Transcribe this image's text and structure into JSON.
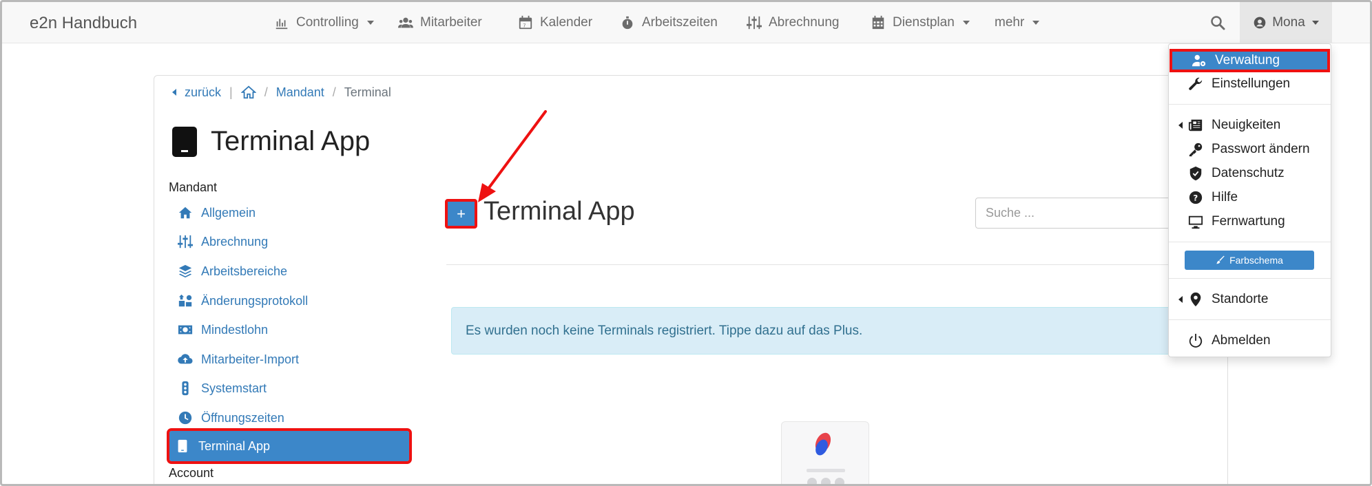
{
  "navbar": {
    "brand": "e2n Handbuch",
    "items": [
      {
        "label": "Controlling",
        "icon": "chart-line-icon",
        "dropdown": true
      },
      {
        "label": "Mitarbeiter",
        "icon": "users-icon",
        "dropdown": false
      },
      {
        "label": "Kalender",
        "icon": "calendar-day-icon",
        "dropdown": false
      },
      {
        "label": "Arbeitszeiten",
        "icon": "stopwatch-icon",
        "dropdown": false
      },
      {
        "label": "Abrechnung",
        "icon": "sliders-icon",
        "dropdown": false
      },
      {
        "label": "Dienstplan",
        "icon": "calendar-grid-icon",
        "dropdown": true
      },
      {
        "label": "mehr",
        "icon": "",
        "dropdown": true
      }
    ],
    "user": "Mona"
  },
  "breadcrumb": {
    "back": "zurück",
    "mandant": "Mandant",
    "current": "Terminal"
  },
  "page": {
    "title": "Terminal App"
  },
  "sidebar": {
    "heading": "Mandant",
    "items": [
      {
        "label": "Allgemein",
        "icon": "home-icon"
      },
      {
        "label": "Abrechnung",
        "icon": "sliders-icon"
      },
      {
        "label": "Arbeitsbereiche",
        "icon": "layers-icon"
      },
      {
        "label": "Änderungsprotokoll",
        "icon": "history-icon"
      },
      {
        "label": "Mindestlohn",
        "icon": "money-bill-icon"
      },
      {
        "label": "Mitarbeiter-Import",
        "icon": "cloud-upload-icon"
      },
      {
        "label": "Systemstart",
        "icon": "traffic-light-icon"
      },
      {
        "label": "Öffnungszeiten",
        "icon": "clock-icon"
      },
      {
        "label": "Terminal App",
        "icon": "tablet-icon",
        "active": true
      }
    ],
    "heading2": "Account"
  },
  "main": {
    "add_label": "+",
    "title": "Terminal App",
    "search_placeholder": "Suche ...",
    "info": "Es wurden noch keine Terminals registriert. Tippe dazu auf das Plus."
  },
  "dropdown": {
    "items": [
      {
        "label": "Verwaltung",
        "icon": "user-cog-icon",
        "active": true
      },
      {
        "label": "Einstellungen",
        "icon": "wrench-icon"
      },
      {
        "label": "Neuigkeiten",
        "icon": "newspaper-icon",
        "submenu": true
      },
      {
        "label": "Passwort ändern",
        "icon": "key-icon"
      },
      {
        "label": "Datenschutz",
        "icon": "shield-icon"
      },
      {
        "label": "Hilfe",
        "icon": "question-circle-icon"
      },
      {
        "label": "Fernwartung",
        "icon": "desktop-icon"
      },
      {
        "label": "Standorte",
        "icon": "map-marker-icon",
        "submenu": true
      },
      {
        "label": "Abmelden",
        "icon": "power-icon"
      }
    ],
    "farbschema": "Farbschema"
  },
  "colors": {
    "accent": "#3c87c9",
    "link": "#337ab7",
    "highlight": "#ee1111",
    "alert_bg": "#d9edf7"
  }
}
